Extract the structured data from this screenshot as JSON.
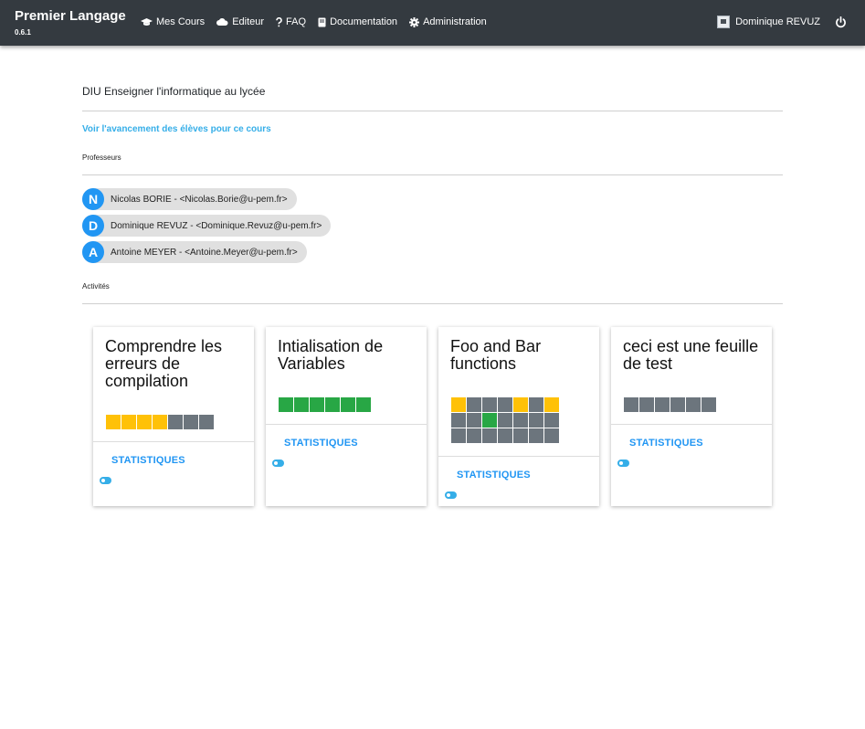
{
  "nav": {
    "brand": "Premier Langage",
    "version": "0.6.1",
    "links": [
      {
        "label": "Mes Cours",
        "icon": "graduation-cap-icon"
      },
      {
        "label": "Editeur",
        "icon": "cloud-icon"
      },
      {
        "label": "FAQ",
        "icon": "question-icon"
      },
      {
        "label": "Documentation",
        "icon": "book-icon"
      },
      {
        "label": "Administration",
        "icon": "gear-icon"
      }
    ],
    "user_name": "Dominique REVUZ",
    "user_icon": "user-badge-icon",
    "logout_icon": "power-icon"
  },
  "course": {
    "title": "DIU Enseigner l'informatique au lycée",
    "progress_link": "Voir l'avancement des élèves pour ce cours",
    "teachers_label": "Professeurs",
    "activities_label": "Activités"
  },
  "teachers": [
    {
      "initial": "N",
      "text": "Nicolas BORIE - <Nicolas.Borie@u-pem.fr>"
    },
    {
      "initial": "D",
      "text": "Dominique REVUZ - <Dominique.Revuz@u-pem.fr>"
    },
    {
      "initial": "A",
      "text": "Antoine MEYER - <Antoine.Meyer@u-pem.fr>"
    }
  ],
  "colors": {
    "navbar": "#343a40",
    "accent": "#2196f3",
    "link": "#35aee8",
    "yellow": "#ffc107",
    "green": "#28a745",
    "gray": "#6c757d"
  },
  "activities": [
    {
      "title": "Comprendre les erreurs de compilation",
      "stats_label": "STATISTIQUES",
      "statuses": [
        "yellow",
        "yellow",
        "yellow",
        "yellow",
        "gray",
        "gray",
        "gray"
      ]
    },
    {
      "title": "Intialisation de Variables",
      "stats_label": "STATISTIQUES",
      "statuses": [
        "green",
        "green",
        "green",
        "green",
        "green",
        "green"
      ]
    },
    {
      "title": "Foo and Bar functions",
      "stats_label": "STATISTIQUES",
      "statuses": [
        "yellow",
        "gray",
        "gray",
        "gray",
        "yellow",
        "gray",
        "yellow",
        "gray",
        "gray",
        "green",
        "gray",
        "gray",
        "gray",
        "gray",
        "gray",
        "gray",
        "gray",
        "gray",
        "gray",
        "gray",
        "gray"
      ]
    },
    {
      "title": "ceci est une feuille de test",
      "stats_label": "STATISTIQUES",
      "statuses": [
        "gray",
        "gray",
        "gray",
        "gray",
        "gray",
        "gray"
      ]
    }
  ]
}
